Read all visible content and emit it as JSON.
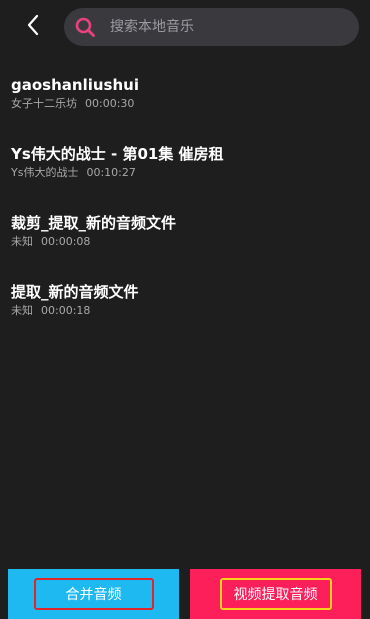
{
  "header": {
    "back_icon": "chevron-left-icon",
    "search": {
      "icon": "search-icon",
      "placeholder": "搜索本地音乐",
      "value": ""
    }
  },
  "songs": [
    {
      "title": "gaoshanliushui",
      "artist": "女子十二乐坊",
      "duration": "00:00:30"
    },
    {
      "title": "Ys伟大的战士 - 第01集 催房租",
      "artist": "Ys伟大的战士",
      "duration": "00:10:27"
    },
    {
      "title": "裁剪_提取_新的音频文件",
      "artist": "未知",
      "duration": "00:00:08"
    },
    {
      "title": "提取_新的音频文件",
      "artist": "未知",
      "duration": "00:00:18"
    }
  ],
  "actions": {
    "merge_label": "合并音频",
    "extract_label": "视频提取音频"
  },
  "colors": {
    "background": "#1e1e1e",
    "search_accent": "#e8427c",
    "merge_button": "#1fb9f2",
    "extract_button": "#fc1f5a",
    "merge_highlight": "#e0262a",
    "extract_highlight": "#f5d31a"
  }
}
